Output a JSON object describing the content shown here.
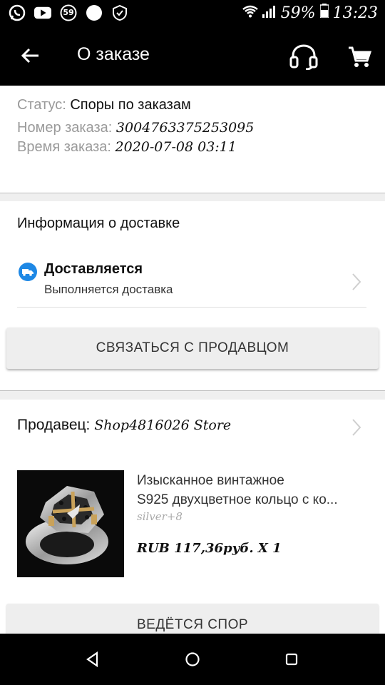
{
  "status_bar": {
    "notif_count": "59",
    "battery": "59%",
    "time": "13:23"
  },
  "toolbar": {
    "title": "О заказе"
  },
  "order": {
    "status_label": "Статус:",
    "status_value": "Споры по заказам",
    "number_label": "Номер заказа:",
    "number_value": "3004763375253095",
    "time_label": "Время заказа:",
    "time_value": "2020-07-08 03:11"
  },
  "delivery": {
    "section_title": "Информация о доставке",
    "state_title": "Доставляется",
    "state_sub": "Выполняется доставка",
    "contact_button": "СВЯЗАТЬСЯ С ПРОДАВЦОМ"
  },
  "seller": {
    "label": "Продавец:",
    "name": "Shop4816026 Store"
  },
  "product": {
    "name_line1": "Изысканное винтажное",
    "name_line2": "S925 двухцветное кольцо с ко...",
    "attribute": "silver+8",
    "price": "RUB 117,36руб. X 1",
    "dispute_button": "ВЕДЁТСЯ СПОР"
  },
  "colors": {
    "bar": "#000000",
    "accent": "#1e88e5",
    "divider": "#efefef"
  }
}
